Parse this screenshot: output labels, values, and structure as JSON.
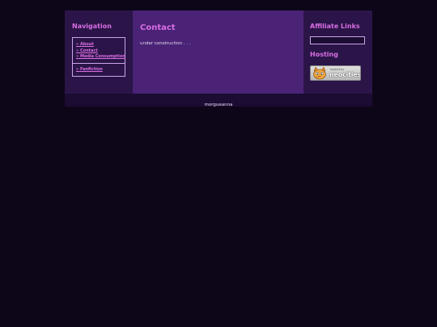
{
  "sidebar": {
    "title": "Navigation",
    "links": [
      "» About",
      "» Contact",
      "» Media Consumption"
    ],
    "extra_link": "» Fanfiction"
  },
  "main": {
    "title": "Contact",
    "body": "under construction . . ."
  },
  "right": {
    "affiliate_title": "Affiliate Links",
    "hosting_title": "Hosting",
    "badge": {
      "small_text": "hosted by",
      "big_text": "neocities",
      "icon": "neocities-cat-icon"
    }
  },
  "footer": {
    "text": "morgueanna"
  },
  "colors": {
    "page_bg": "#0d0619",
    "side_bg": "#2b1548",
    "main_bg": "#4a2376",
    "footer_bg": "#1c0b33",
    "accent": "#d96ee3"
  }
}
